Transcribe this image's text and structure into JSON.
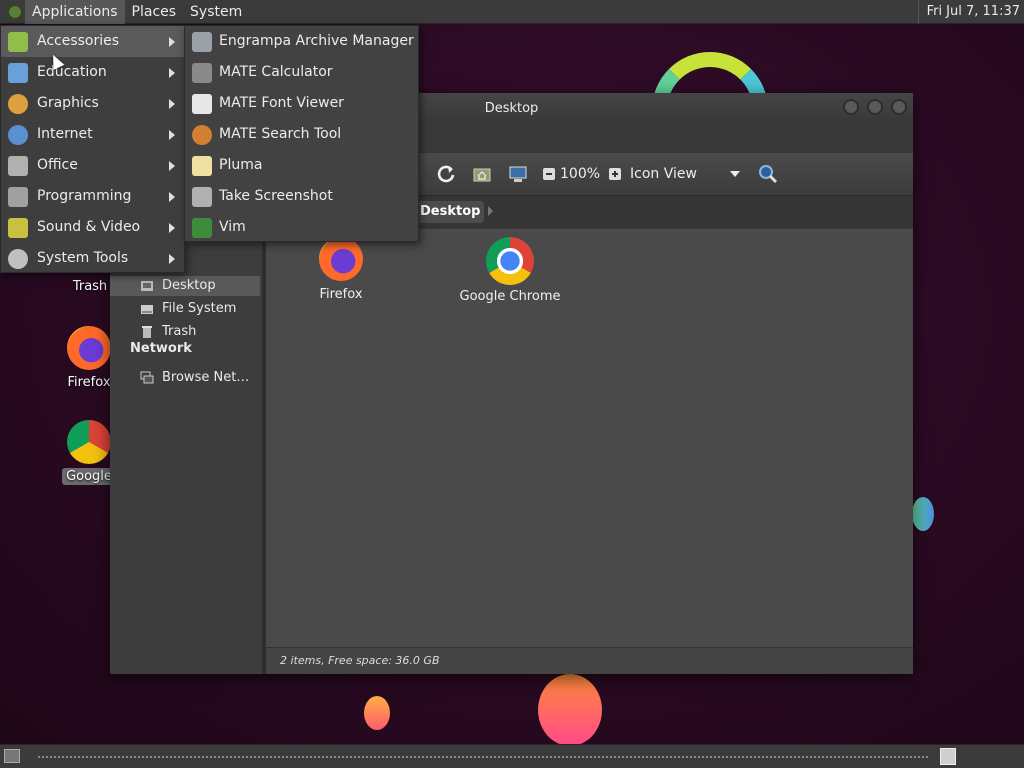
{
  "top_panel": {
    "menus": [
      "Applications",
      "Places",
      "System"
    ],
    "clock": "Fri Jul  7, 11:37"
  },
  "desktop_icons": [
    {
      "label": "Trash",
      "icon": "trash-icon"
    },
    {
      "label": "Firefox",
      "icon": "firefox-icon"
    },
    {
      "label": "Google",
      "icon": "chrome-icon",
      "selected": true
    }
  ],
  "app_menu": {
    "categories": [
      {
        "label": "Accessories",
        "icon": "accessories-icon",
        "color": "#8fbf4a"
      },
      {
        "label": "Education",
        "icon": "education-icon",
        "color": "#6a9fd8"
      },
      {
        "label": "Graphics",
        "icon": "graphics-icon",
        "color": "#e0a040"
      },
      {
        "label": "Internet",
        "icon": "internet-icon",
        "color": "#5a8fd0"
      },
      {
        "label": "Office",
        "icon": "office-icon",
        "color": "#b0b0b0"
      },
      {
        "label": "Programming",
        "icon": "programming-icon",
        "color": "#a0a0a0"
      },
      {
        "label": "Sound & Video",
        "icon": "sound-video-icon",
        "color": "#c9c040"
      },
      {
        "label": "System Tools",
        "icon": "system-tools-icon",
        "color": "#c0c0c0"
      }
    ],
    "active_category": "Accessories"
  },
  "accessories_submenu": [
    {
      "label": "Engrampa Archive Manager",
      "icon": "archive-icon"
    },
    {
      "label": "MATE Calculator",
      "icon": "calculator-icon"
    },
    {
      "label": "MATE Font Viewer",
      "icon": "font-viewer-icon"
    },
    {
      "label": "MATE Search Tool",
      "icon": "search-tool-icon"
    },
    {
      "label": "Pluma",
      "icon": "text-editor-icon"
    },
    {
      "label": "Take Screenshot",
      "icon": "screenshot-icon"
    },
    {
      "label": "Vim",
      "icon": "vim-icon"
    }
  ],
  "file_manager": {
    "title": "Desktop",
    "toolbar": {
      "zoom": "100%",
      "view_mode": "Icon View"
    },
    "location": "Desktop",
    "sidebar": {
      "places": [
        {
          "label": "Desktop",
          "icon": "desktop-folder-icon",
          "selected": true
        },
        {
          "label": "File System",
          "icon": "filesystem-icon"
        },
        {
          "label": "Trash",
          "icon": "trash-icon"
        }
      ],
      "network_header": "Network",
      "network": [
        {
          "label": "Browse Net…",
          "icon": "network-icon"
        }
      ]
    },
    "files": [
      {
        "label": "Firefox",
        "icon": "firefox-icon"
      },
      {
        "label": "Google Chrome",
        "icon": "chrome-icon"
      }
    ],
    "status": "2 items, Free space: 36.0 GB"
  }
}
